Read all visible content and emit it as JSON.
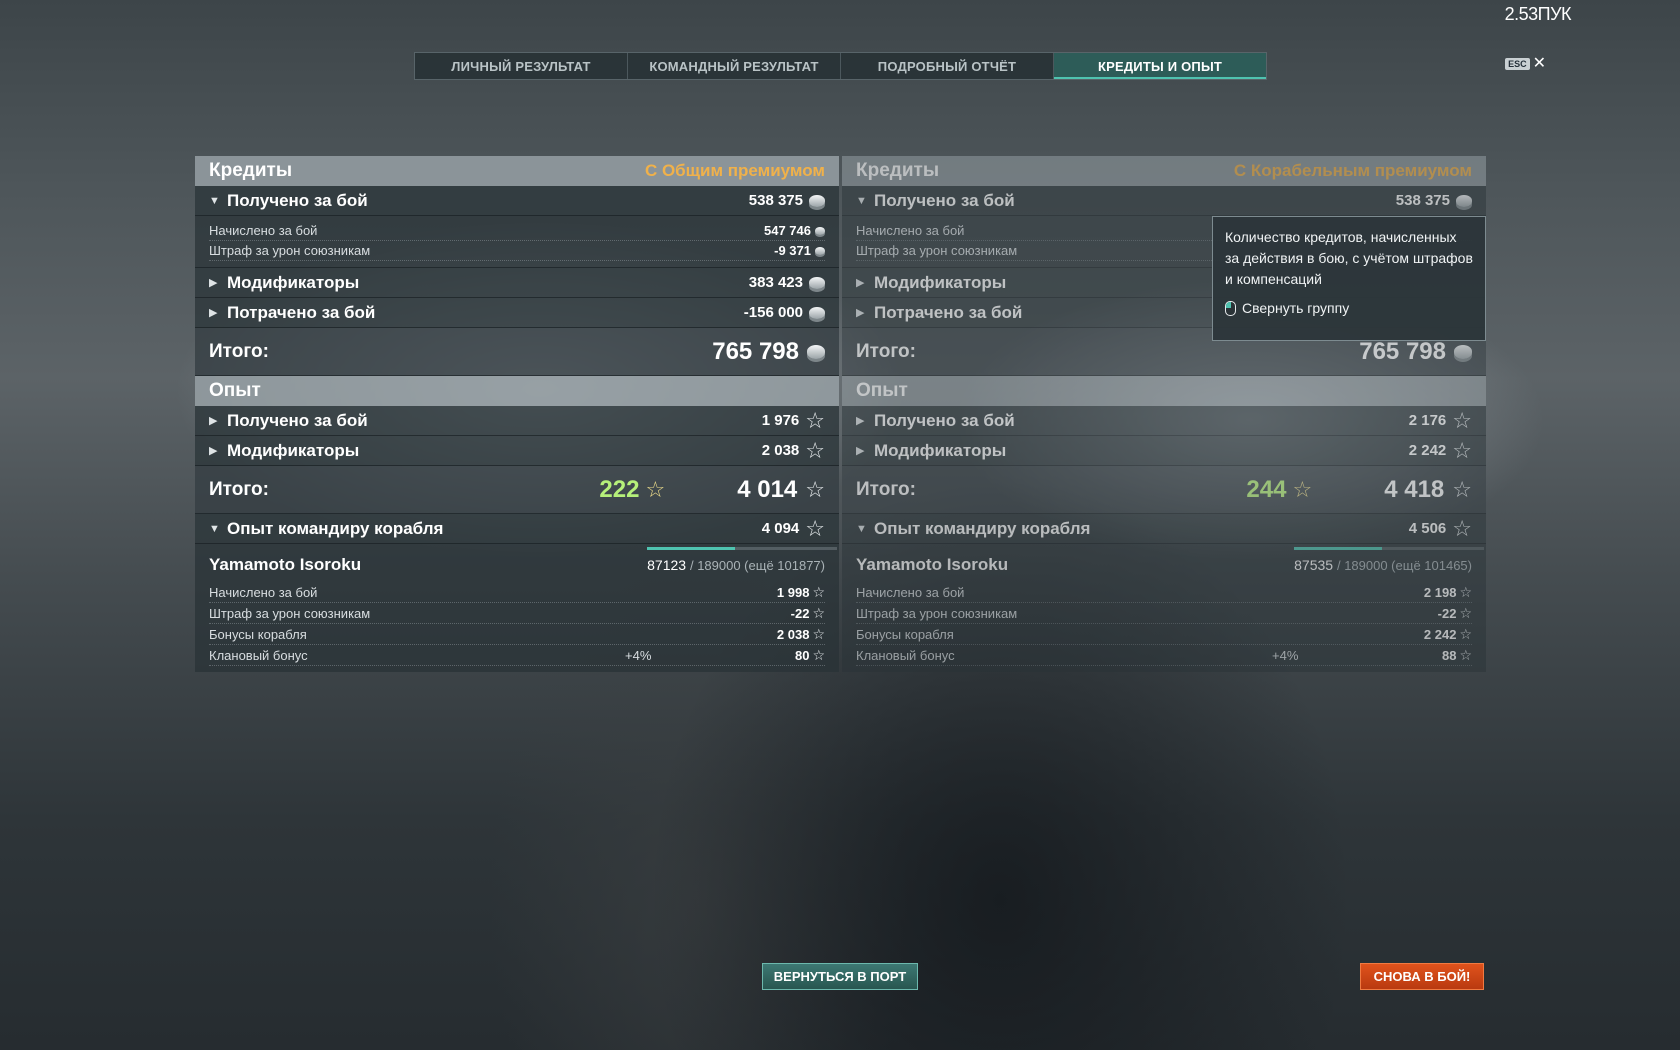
{
  "fps_counter": "2.53ПУК",
  "tabs": [
    {
      "label": "ЛИЧНЫЙ РЕЗУЛЬТАТ",
      "active": false
    },
    {
      "label": "КОМАНДНЫЙ РЕЗУЛЬТАТ",
      "active": false
    },
    {
      "label": "ПОДРОБНЫЙ ОТЧЁТ",
      "active": false
    },
    {
      "label": "КРЕДИТЫ И ОПЫТ",
      "active": true
    }
  ],
  "esc": {
    "key": "ESC",
    "close": "✕"
  },
  "icons": {
    "credits": "coin-icon",
    "experience": "star-icon",
    "expand": "chevron-right-icon",
    "collapse": "chevron-down-icon"
  },
  "colors": {
    "premium": "#f0b14a",
    "accent": "#4fc3b0",
    "free_exp": "#b6f07a",
    "battle_button": "#d04a16"
  },
  "left": {
    "credits_title": "Кредиты",
    "premium_label": "С Общим премиумом",
    "earned": {
      "label": "Получено за бой",
      "value": "538 375"
    },
    "earned_details": [
      {
        "label": "Начислено за бой",
        "value": "547 746"
      },
      {
        "label": "Штраф за урон союзникам",
        "value": "-9 371"
      }
    ],
    "modifiers": {
      "label": "Модификаторы",
      "value": "383 423"
    },
    "spent": {
      "label": "Потрачено за бой",
      "value": "-156 000"
    },
    "credits_total": {
      "label": "Итого:",
      "value": "765 798"
    },
    "exp_title": "Опыт",
    "exp_earned": {
      "label": "Получено за бой",
      "value": "1 976"
    },
    "exp_modifiers": {
      "label": "Модификаторы",
      "value": "2 038"
    },
    "exp_total": {
      "label": "Итого:",
      "free": "222",
      "value": "4 014"
    },
    "commander": {
      "label": "Опыт командиру корабля",
      "value": "4 094",
      "name": "Yamamoto Isoroku",
      "current": "87123",
      "needed": "/ 189000 (ещё 101877)",
      "progress": 0.461,
      "rows": [
        {
          "label": "Начислено за бой",
          "pct": "",
          "value": "1 998"
        },
        {
          "label": "Штраф за урон союзникам",
          "pct": "",
          "value": "-22"
        },
        {
          "label": "Бонусы корабля",
          "pct": "",
          "value": "2 038"
        },
        {
          "label": "Клановый бонус",
          "pct": "+4%",
          "value": "80"
        }
      ]
    }
  },
  "right": {
    "credits_title": "Кредиты",
    "premium_label": "С Корабельным премиумом",
    "earned": {
      "label": "Получено за бой",
      "value": "538 375"
    },
    "earned_details": [
      {
        "label": "Начислено за бой",
        "value": ""
      },
      {
        "label": "Штраф за урон союзникам",
        "value": ""
      }
    ],
    "modifiers": {
      "label": "Модификаторы",
      "value": ""
    },
    "spent": {
      "label": "Потрачено за бой",
      "value": ""
    },
    "credits_total": {
      "label": "Итого:",
      "value": "765 798"
    },
    "exp_title": "Опыт",
    "exp_earned": {
      "label": "Получено за бой",
      "value": "2 176"
    },
    "exp_modifiers": {
      "label": "Модификаторы",
      "value": "2 242"
    },
    "exp_total": {
      "label": "Итого:",
      "free": "244",
      "value": "4 418"
    },
    "commander": {
      "label": "Опыт командиру корабля",
      "value": "4 506",
      "name": "Yamamoto Isoroku",
      "current": "87535",
      "needed": "/ 189000 (ещё 101465)",
      "progress": 0.463,
      "rows": [
        {
          "label": "Начислено за бой",
          "pct": "",
          "value": "2 198"
        },
        {
          "label": "Штраф за урон союзникам",
          "pct": "",
          "value": "-22"
        },
        {
          "label": "Бонусы корабля",
          "pct": "",
          "value": "2 242"
        },
        {
          "label": "Клановый бонус",
          "pct": "+4%",
          "value": "88"
        }
      ]
    }
  },
  "tooltip": {
    "text": "Количество кредитов, начисленных за действия в бою, с учётом штрафов и компенсаций",
    "hint": "Свернуть группу"
  },
  "buttons": {
    "port": "ВЕРНУТЬСЯ В ПОРТ",
    "battle": "СНОВА В БОЙ!"
  }
}
